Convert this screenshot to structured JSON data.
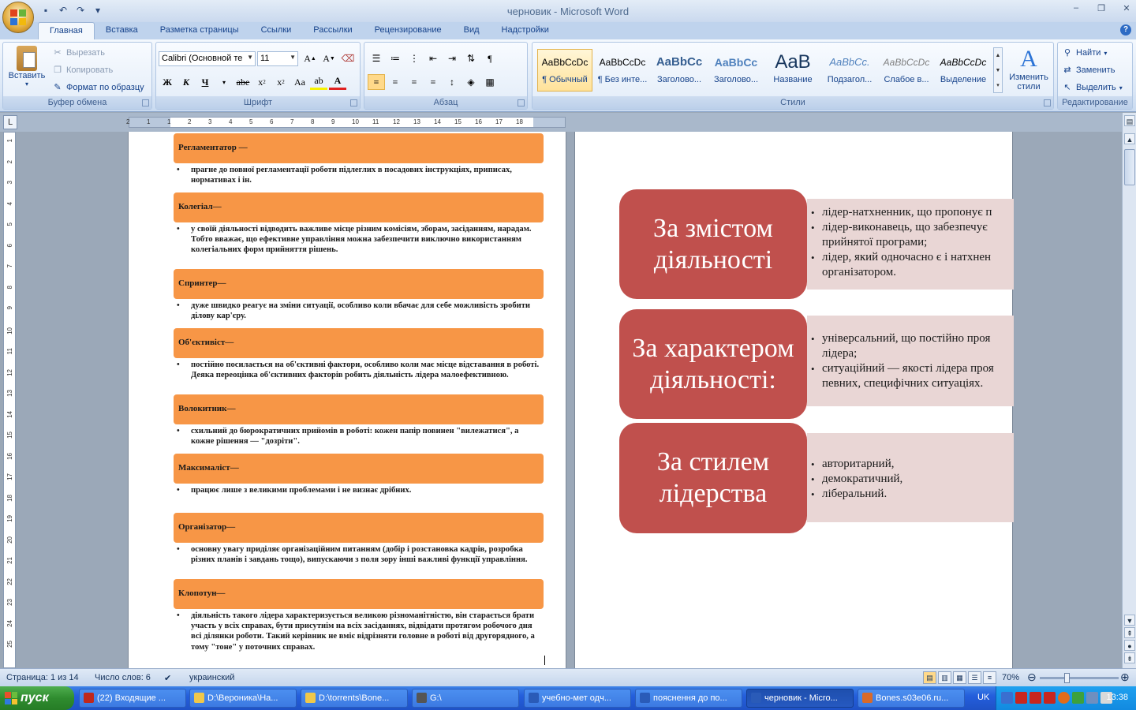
{
  "window": {
    "title": "черновик - Microsoft Word",
    "controls": [
      "–",
      "❐",
      "✕"
    ]
  },
  "qat": {
    "save_icon": "save-icon",
    "undo_icon": "undo-icon",
    "redo_icon": "redo-icon",
    "customize_icon": "customize-icon"
  },
  "ribbon": {
    "tabs": [
      "Главная",
      "Вставка",
      "Разметка страницы",
      "Ссылки",
      "Рассылки",
      "Рецензирование",
      "Вид",
      "Надстройки"
    ],
    "active_tab": "Главная",
    "clipboard": {
      "label": "Буфер обмена",
      "paste": "Вставить",
      "cut": "Вырезать",
      "copy": "Копировать",
      "format_painter": "Формат по образцу"
    },
    "font": {
      "label": "Шрифт",
      "family": "Calibri (Основной те",
      "size": "11"
    },
    "paragraph": {
      "label": "Абзац"
    },
    "styles": {
      "label": "Стили",
      "items": [
        {
          "sample": "AaBbCcDc",
          "name": "¶ Обычный"
        },
        {
          "sample": "AaBbCcDc",
          "name": "¶ Без инте..."
        },
        {
          "sample": "AaBbCc",
          "name": "Заголово..."
        },
        {
          "sample": "AaBbCc",
          "name": "Заголово..."
        },
        {
          "sample": "AaB",
          "name": "Название"
        },
        {
          "sample": "AaBbCc.",
          "name": "Подзагол..."
        },
        {
          "sample": "AaBbCcDc",
          "name": "Слабое в..."
        },
        {
          "sample": "AaBbCcDc",
          "name": "Выделение"
        }
      ],
      "change_styles_line1": "Изменить",
      "change_styles_line2": "стили"
    },
    "editing": {
      "label": "Редактирование",
      "find": "Найти",
      "replace": "Заменить",
      "select": "Выделить"
    }
  },
  "page1": {
    "items": [
      {
        "title": "Регламентатор —",
        "text": "прагне до повної регламентації роботи підлеглих в посадових інструкціях, приписах, нормативах і ін."
      },
      {
        "title": "Колегіал—",
        "text": "у своїй діяльності відводить важливе місце різним комісіям, зборам, засіданням, нарадам. Тобто вважає, що ефективне управління можна забезпечити виключно використанням колегіальних форм прийняття рішень."
      },
      {
        "title": "Спринтер—",
        "text": "дуже швидко реагує на зміни ситуації, особливо коли вбачає для себе можливість зробити ділову кар'єру."
      },
      {
        "title": "Об'єктивіст—",
        "text": "постійно посилається на об'єктивні фактори, особливо коли має місце відставання в роботі. Деяка переоцінка об'єктивних факторів робить діяльність лідера малоефективною."
      },
      {
        "title": "Волокитник—",
        "text": "схильний до бюрократичних прийомів в роботі: кожен папір повинен \"вилежатися\", а кожне рішення — \"дозріти\"."
      },
      {
        "title": "Максималіст—",
        "text": "працює лише з великими проблемами і не визнає дрібних."
      },
      {
        "title": "Організатор—",
        "text": "основну увагу приділяє організаційним питанням (добір і розстановка кадрів, розробка різних планів і завдань тощо), випускаючи з поля зору інші важливі функції управління."
      },
      {
        "title": "Клопотун—",
        "text": "діяльність такого лідера характеризується великою різноманітністю, він старається брати участь у всіх справах, бути присутнім на всіх засіданнях, відвідати протягом робочого дня всі ділянки роботи. Такий керівник не вміє відрізняти головне в роботі від другорядного, а тому \"тоне\" у поточних справах."
      }
    ]
  },
  "page2": {
    "categories": [
      {
        "title": "За змістом діяльності",
        "bullets": [
          "лідер-натхненник, що пропонує п",
          "лідер-виконавець, що забезпечує",
          "прийнятої програми;",
          "лідер, який одночасно є і натхнен",
          "організатором."
        ]
      },
      {
        "title": "За характером діяльності:",
        "bullets": [
          "універсальний, що постійно проя",
          "лідера;",
          "ситуаційний — якості лідера проя",
          "певних, специфічних ситуаціях."
        ]
      },
      {
        "title": "За стилем лідерства",
        "bullets": [
          "авторитарний,",
          "демократичний,",
          "ліберальний."
        ]
      }
    ]
  },
  "ruler": {
    "h_ticks": [
      "2",
      "1",
      "1",
      "2",
      "3",
      "4",
      "5",
      "6",
      "7",
      "8",
      "9",
      "10",
      "11",
      "12",
      "13",
      "14",
      "15",
      "16",
      "17",
      "18"
    ],
    "v_ticks": [
      "1",
      "2",
      "3",
      "4",
      "5",
      "6",
      "7",
      "8",
      "9",
      "10",
      "11",
      "12",
      "13",
      "14",
      "15",
      "16",
      "17",
      "18",
      "19",
      "20",
      "21",
      "22",
      "23",
      "24",
      "25"
    ]
  },
  "status": {
    "page": "Страница: 1 из 14",
    "words": "Число слов: 6",
    "language": "украинский",
    "zoom": "70%"
  },
  "taskbar": {
    "start": "пуск",
    "tasks": [
      {
        "label": "(22) Входящие ...",
        "color": "#c0281c"
      },
      {
        "label": "D:\\Вероника\\На...",
        "color": "#f0c84a"
      },
      {
        "label": "D:\\torrents\\Bone...",
        "color": "#f0c84a"
      },
      {
        "label": "G:\\",
        "color": "#555555"
      },
      {
        "label": "учебно-мет одч...",
        "color": "#2a5bb8"
      },
      {
        "label": "пояснення до по...",
        "color": "#2a5bb8"
      },
      {
        "label": "черновик - Micro...",
        "color": "#2a5bb8"
      },
      {
        "label": "Bones.s03e06.ru...",
        "color": "#d86a2a"
      }
    ],
    "lang": "UK",
    "clock": "13:38"
  }
}
